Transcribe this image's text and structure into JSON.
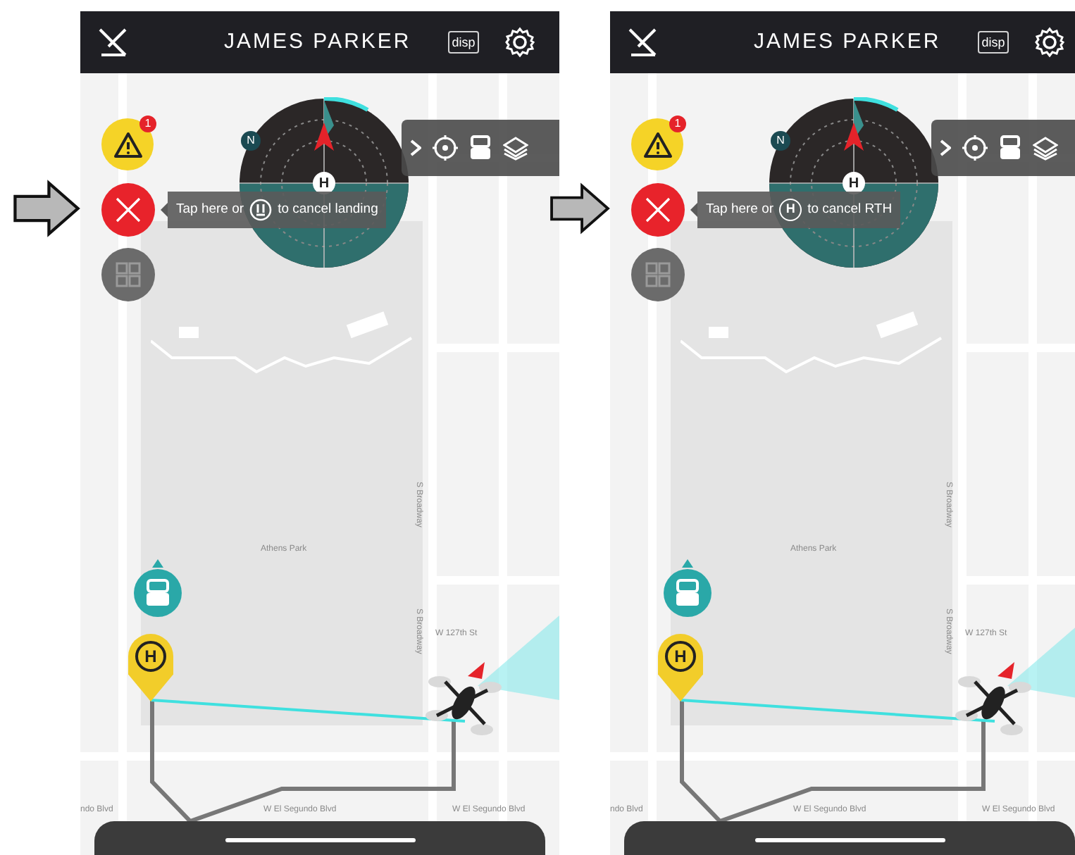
{
  "phones": [
    {
      "header": {
        "title": "JAMES PARKER",
        "display_button": "disp"
      },
      "warning_badge": "1",
      "compass": {
        "north": "N",
        "home": "H"
      },
      "tooltip": {
        "before": "Tap here or",
        "key": {
          "kind": "icon"
        },
        "after": "to cancel landing"
      },
      "home_marker": "H",
      "map_labels": [
        "S Broadway",
        "Athens Park",
        "S Broadway",
        "W 127th St",
        "ndo Blvd",
        "W El Segundo Blvd",
        "W El Segundo Blvd"
      ]
    },
    {
      "header": {
        "title": "JAMES PARKER",
        "display_button": "disp"
      },
      "warning_badge": "1",
      "compass": {
        "north": "N",
        "home": "H"
      },
      "tooltip": {
        "before": "Tap here or",
        "key": {
          "kind": "letter",
          "label": "H"
        },
        "after": "to cancel RTH"
      },
      "home_marker": "H",
      "map_labels": [
        "S Broadway",
        "Athens Park",
        "S Broadway",
        "W 127th St",
        "ndo Blvd",
        "W El Segundo Blvd",
        "W El Segundo Blvd"
      ]
    }
  ]
}
